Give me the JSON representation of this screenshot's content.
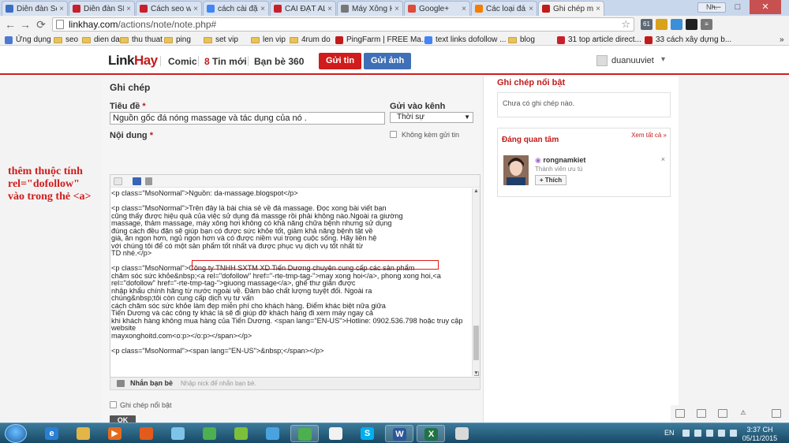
{
  "browser": {
    "tabs": [
      {
        "title": "Diễn đàn Seo",
        "color": "#3a6fc4"
      },
      {
        "title": "Diễn đàn SEO",
        "color": "#c8202b"
      },
      {
        "title": "Cách seo web",
        "color": "#c8202b"
      },
      {
        "title": "cách cài đặt a",
        "color": "#4285f4"
      },
      {
        "title": "CÀI ĐẶT ALEX",
        "color": "#c8202b"
      },
      {
        "title": "Máy Xông Hơ",
        "color": "#777777"
      },
      {
        "title": "Google+",
        "color": "#dd4b39"
      },
      {
        "title": "Các loại đá dù",
        "color": "#f57d00"
      },
      {
        "title": "Ghi chép mới",
        "color": "#c21b1b"
      }
    ],
    "tab_close": "×",
    "profile_name": "Nh.",
    "window_buttons": {
      "minimize": "—",
      "maximize": "□",
      "close": "✕"
    },
    "url_host": "linkhay.com",
    "url_path": "/actions/note/note.php#",
    "nav": {
      "back": "←",
      "forward": "→",
      "reload": "⟳"
    },
    "star": "☆",
    "extensions": [
      {
        "label": "61",
        "color": "#5d6a75"
      },
      {
        "label": "",
        "color": "#d9a21b"
      },
      {
        "label": "",
        "color": "#3b8ed8"
      },
      {
        "label": "",
        "color": "#222222"
      },
      {
        "label": "≡",
        "color": "#777777"
      }
    ],
    "bookmarks": [
      {
        "label": "Ứng dụng",
        "kind": "apps"
      },
      {
        "label": "seo",
        "kind": "folder"
      },
      {
        "label": "dien dan",
        "kind": "folder"
      },
      {
        "label": "thu thuat",
        "kind": "folder"
      },
      {
        "label": "ping",
        "kind": "folder"
      },
      {
        "label": "set vip",
        "kind": "folder"
      },
      {
        "label": "len vip",
        "kind": "folder"
      },
      {
        "label": "4rum do",
        "kind": "folder"
      },
      {
        "label": "PingFarm | FREE Ma...",
        "kind": "site"
      },
      {
        "label": "text links dofollow ...",
        "kind": "google"
      },
      {
        "label": "blog",
        "kind": "folder"
      },
      {
        "label": "31 top article direct...",
        "kind": "idvi"
      },
      {
        "label": "33 cách xây dựng b...",
        "kind": "site"
      }
    ],
    "bookmarks_more": "»"
  },
  "site": {
    "logo_dark": "Link",
    "logo_red": "Hay",
    "nav": {
      "comic": "Comic",
      "notif_count": "8",
      "notif_label": "Tin mới",
      "friends": "Bạn bè 360"
    },
    "post_news": "Gửi tin",
    "post_photo": "Gửi ảnh",
    "username": "duanuuviet",
    "caret": "▾"
  },
  "form": {
    "section_title": "Ghi chép",
    "title_label": "Tiêu đề",
    "required_mark": "*",
    "title_value": "Nguồn gốc đá nóng massage và tác dụng của nó .",
    "channel_label": "Gửi vào kênh",
    "channel_value": "Thời sự",
    "no_attach_label": "Không kèm gửi tin",
    "content_label": "Nội dung",
    "editor_lines": [
      "<p class=\"MsoNormal\">Nguồn: da-massage.blogspot</p>",
      "",
      "<p class=\"MsoNormal\">Trên đây là bài chia sẻ về đá massage. Đọc xong bài viết bạn",
      "cũng thấy được hiệu quả của việc sử dụng đá massge rồi phải không nào.Ngoài ra giường",
      "massage, thảm massage, máy xông hơi không có khả năng chữa bệnh nhưng sử dụng",
      "đúng cách đều đặn sẽ giúp bạn có được sức khỏe tốt, giảm khả năng bệnh tật về",
      "già, ăn ngon hơn, ngủ ngon hơn và có được niềm vui trong cuộc sống. Hãy liên hệ",
      "với chúng tôi để có một sản phẩm tốt nhất và được phục vụ dịch vụ tốt nhất từ",
      "TD nhé.</p>",
      "",
      "<p class=\"MsoNormal\">Công ty TNHH SXTM XD Tiến Dương chuyên cung cấp các sản phẩm",
      "chăm sóc sức khỏe&nbsp;<a rel=\"dofollow\" href=\"-rte-tmp-tag-\">may xong hoi</a>, phong xong hoi,<a",
      "rel=\"dofollow\" href=\"-rte-tmp-tag-\">giuong massage</a>, ghế thư giãn được",
      "nhập khẩu chính hãng từ nước ngoài về. Đảm bảo chất lượng tuyệt đối. Ngoài ra",
      "chúng&nbsp;tôi còn cung cấp dịch vụ tư vấn",
      "cách chăm sóc sức khỏe làm đẹp miễn phí cho khách hàng. Điểm khác biệt nữa giữa",
      "Tiến Dương và các công ty khác là sẽ đi giúp đỡ khách hàng đi xem máy ngay cả",
      "khi khách hàng không mua hàng của Tiến Dương. <span lang=\"EN-US\">Hotline: 0902.536.798 hoặc truy cập",
      "website",
      "mayxonghoitd.com<o:p></o:p></span></p>",
      "",
      "<p class=\"MsoNormal\"><span lang=\"EN-US\">&nbsp;</span></p>"
    ],
    "tag_friends_label": "Nhắn bạn bè",
    "tag_friends_placeholder": "Nhập nick để nhắn bạn bè.",
    "featured_label": "Ghi chép nổi bật",
    "ok_label": "OK"
  },
  "annotation": {
    "line1": "thêm thuộc tính",
    "line2": "rel=\"dofollow\"",
    "line3": "vào trong thẻ <a>"
  },
  "sidebar": {
    "featured_title": "Ghi chép nổi bật",
    "no_featured": "Chưa có ghi chép nào.",
    "following_title": "Đáng quan tâm",
    "view_all": "Xem tất cả »",
    "person_name": "rongnamkiet",
    "person_sub": "Thành viên ưu tú",
    "like_label": "+ Thích",
    "dismiss": "×"
  },
  "taskbar": {
    "apps": [
      {
        "name": "internet-explorer",
        "glyph": "e",
        "color": "#2a7fd4",
        "open": false
      },
      {
        "name": "file-explorer",
        "glyph": "",
        "color": "#e3b548",
        "open": false
      },
      {
        "name": "media-player",
        "glyph": "▶",
        "color": "#e46b1e",
        "open": false
      },
      {
        "name": "firefox",
        "glyph": "",
        "color": "#e35b1c",
        "open": false
      },
      {
        "name": "photo-tool",
        "glyph": "",
        "color": "#7ec4e8",
        "open": false
      },
      {
        "name": "chrome",
        "glyph": "",
        "color": "#4caf50",
        "open": false
      },
      {
        "name": "coccoc",
        "glyph": "",
        "color": "#7bbf3a",
        "open": false
      },
      {
        "name": "app-grid",
        "glyph": "",
        "color": "#4aa3df",
        "open": false
      },
      {
        "name": "chrome-active",
        "glyph": "",
        "color": "#4caf50",
        "open": true
      },
      {
        "name": "search-tool",
        "glyph": "",
        "color": "#f2f2f2",
        "open": false
      },
      {
        "name": "skype",
        "glyph": "S",
        "color": "#00aff0",
        "open": false
      },
      {
        "name": "word",
        "glyph": "W",
        "color": "#2b579a",
        "open": true
      },
      {
        "name": "excel",
        "glyph": "X",
        "color": "#217346",
        "open": true
      },
      {
        "name": "paint",
        "glyph": "",
        "color": "#d9d9d9",
        "open": false
      }
    ],
    "language": "EN",
    "time": "3:37 CH",
    "date": "05/11/2015"
  }
}
